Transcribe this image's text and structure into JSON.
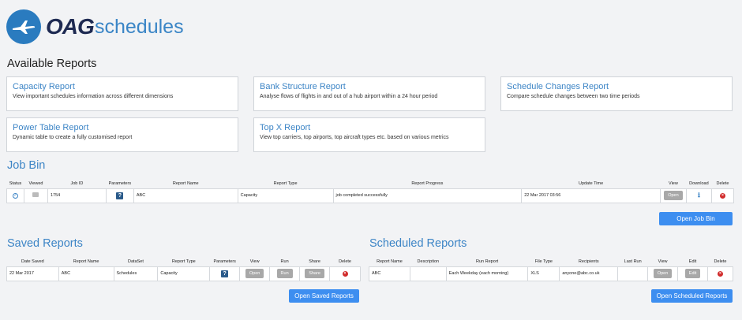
{
  "logo": {
    "brand": "OAG",
    "product": "schedules"
  },
  "available_reports": {
    "title": "Available Reports",
    "cards": [
      {
        "title": "Capacity Report",
        "desc": "View important schedules information across different dimensions"
      },
      {
        "title": "Bank Structure Report",
        "desc": "Analyse flows of flights in and out of a hub airport within a 24 hour period"
      },
      {
        "title": "Schedule Changes Report",
        "desc": "Compare schedule changes between two time periods"
      },
      {
        "title": "Power Table Report",
        "desc": "Dynamic table to create a fully customised report"
      },
      {
        "title": "Top X Report",
        "desc": "View top carriers, top airports, top aircraft types etc. based on various metrics"
      }
    ]
  },
  "job_bin": {
    "title": "Job Bin",
    "headers": [
      "Status",
      "Viewed",
      "Job ID",
      "Parameters",
      "Report Name",
      "Report Type",
      "Report Progress",
      "Update Time",
      "View",
      "Download",
      "Delete"
    ],
    "row": {
      "job_id": "1754",
      "report_name": "ABC",
      "report_type": "Capacity",
      "progress": "job completed successfully",
      "update_time": "22 Mar 2017 03:56",
      "view_label": "Open"
    },
    "open_button": "Open Job Bin"
  },
  "saved_reports": {
    "title": "Saved Reports",
    "headers": [
      "Date Saved",
      "Report Name",
      "DataSet",
      "Report Type",
      "Parameters",
      "View",
      "Run",
      "Share",
      "Delete"
    ],
    "row": {
      "date_saved": "22 Mar 2017",
      "report_name": "ABC",
      "dataset": "Schedules",
      "report_type": "Capacity",
      "view_label": "Open",
      "run_label": "Run",
      "share_label": "Share"
    },
    "open_button": "Open Saved Reports"
  },
  "scheduled_reports": {
    "title": "Scheduled Reports",
    "headers": [
      "Report Name",
      "Description",
      "Run Report",
      "File Type",
      "Recipients",
      "Last Run",
      "View",
      "Edit",
      "Delete"
    ],
    "row": {
      "report_name": "ABC",
      "description": "",
      "run_report": "Each Weekday (each morning)",
      "file_type": "XLS",
      "recipients": "anyone@abc.co.uk",
      "last_run": "",
      "view_label": "Open",
      "edit_label": "Edit"
    },
    "open_button": "Open Scheduled Reports"
  },
  "colors": {
    "accent": "#3d85c6",
    "button_blue": "#3d8ef0",
    "delete_red": "#d12b2b"
  }
}
